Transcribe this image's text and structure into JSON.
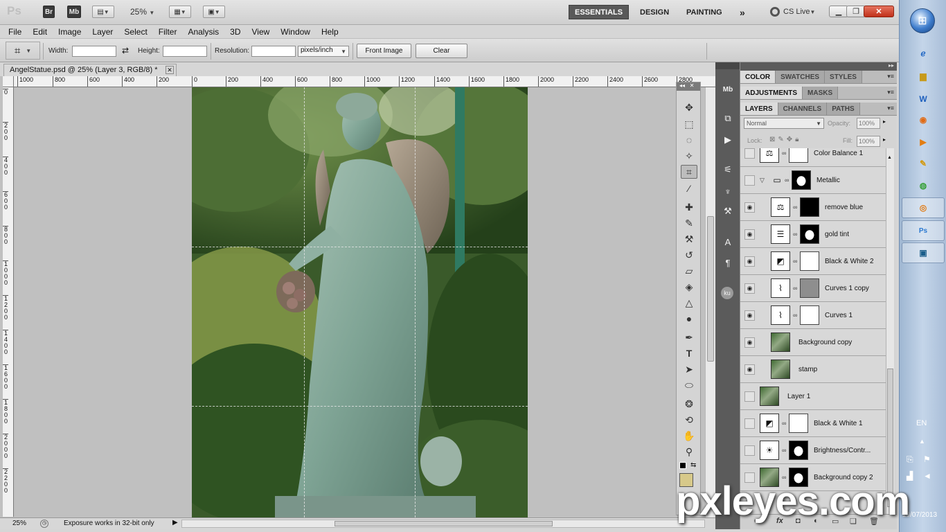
{
  "appbar": {
    "br_label": "Br",
    "mb_label": "Mb",
    "zoom_value": "25%",
    "workspaces": [
      "ESSENTIALS",
      "DESIGN",
      "PAINTING"
    ],
    "more_label": "»",
    "cslive_label": "CS Live",
    "ps_logo": "Ps"
  },
  "menu": [
    "File",
    "Edit",
    "Image",
    "Layer",
    "Select",
    "Filter",
    "Analysis",
    "3D",
    "View",
    "Window",
    "Help"
  ],
  "options": {
    "width_label": "Width:",
    "width_value": "",
    "height_label": "Height:",
    "height_value": "",
    "resolution_label": "Resolution:",
    "resolution_value": "",
    "units": "pixels/inch",
    "front_image_label": "Front Image",
    "clear_label": "Clear"
  },
  "document": {
    "tab_title": "AngelStatue.psd @ 25% (Layer 3, RGB/8) *",
    "hruler_labels": [
      "1000",
      "800",
      "600",
      "400",
      "200",
      "0",
      "200",
      "400",
      "600",
      "800",
      "1000",
      "1200",
      "1400",
      "1600",
      "1800",
      "2000",
      "2200",
      "2400",
      "2600",
      "2800"
    ],
    "vruler_labels": [
      "0",
      "200",
      "400",
      "600",
      "800",
      "1000",
      "1200",
      "1400",
      "1600",
      "1800",
      "2000",
      "2200"
    ],
    "status_zoom": "25%",
    "status_text": "Exposure works in 32-bit only"
  },
  "panels": {
    "group1_tabs": [
      "COLOR",
      "SWATCHES",
      "STYLES"
    ],
    "group2_tabs": [
      "ADJUSTMENTS",
      "MASKS"
    ],
    "group3_tabs": [
      "LAYERS",
      "CHANNELS",
      "PATHS"
    ],
    "blend_mode": "Normal",
    "opacity_label": "Opacity:",
    "opacity_value": "100%",
    "lock_label": "Lock:",
    "fill_label": "Fill:",
    "fill_value": "100%",
    "layers": [
      {
        "name": "Color Balance 1",
        "visible": false,
        "thumb": "balance",
        "mask": "white"
      },
      {
        "name": "Metallic",
        "visible": false,
        "thumb": "folder",
        "mask": "stat",
        "group": true
      },
      {
        "name": "remove blue",
        "visible": true,
        "thumb": "scale",
        "mask": "black"
      },
      {
        "name": "gold tint",
        "visible": true,
        "thumb": "levels",
        "mask": "stat"
      },
      {
        "name": "Black & White 2",
        "visible": true,
        "thumb": "bw",
        "mask": "white"
      },
      {
        "name": "Curves 1 copy",
        "visible": true,
        "thumb": "curves",
        "mask": "gray"
      },
      {
        "name": "Curves 1",
        "visible": true,
        "thumb": "curves",
        "mask": "white"
      },
      {
        "name": "Background copy",
        "visible": true,
        "thumb": "image",
        "mask": ""
      },
      {
        "name": "stamp",
        "visible": true,
        "thumb": "image",
        "mask": ""
      },
      {
        "name": "Layer 1",
        "visible": false,
        "thumb": "image",
        "mask": ""
      },
      {
        "name": "Black & White 1",
        "visible": false,
        "thumb": "bw",
        "mask": "white"
      },
      {
        "name": "Brightness/Contr...",
        "visible": false,
        "thumb": "sun",
        "mask": "stat"
      },
      {
        "name": "Background copy 2",
        "visible": false,
        "thumb": "image",
        "mask": "stat"
      }
    ]
  },
  "taskbar": {
    "lang": "EN",
    "date": "19/07/2013"
  },
  "watermark": "pxleyes.com"
}
